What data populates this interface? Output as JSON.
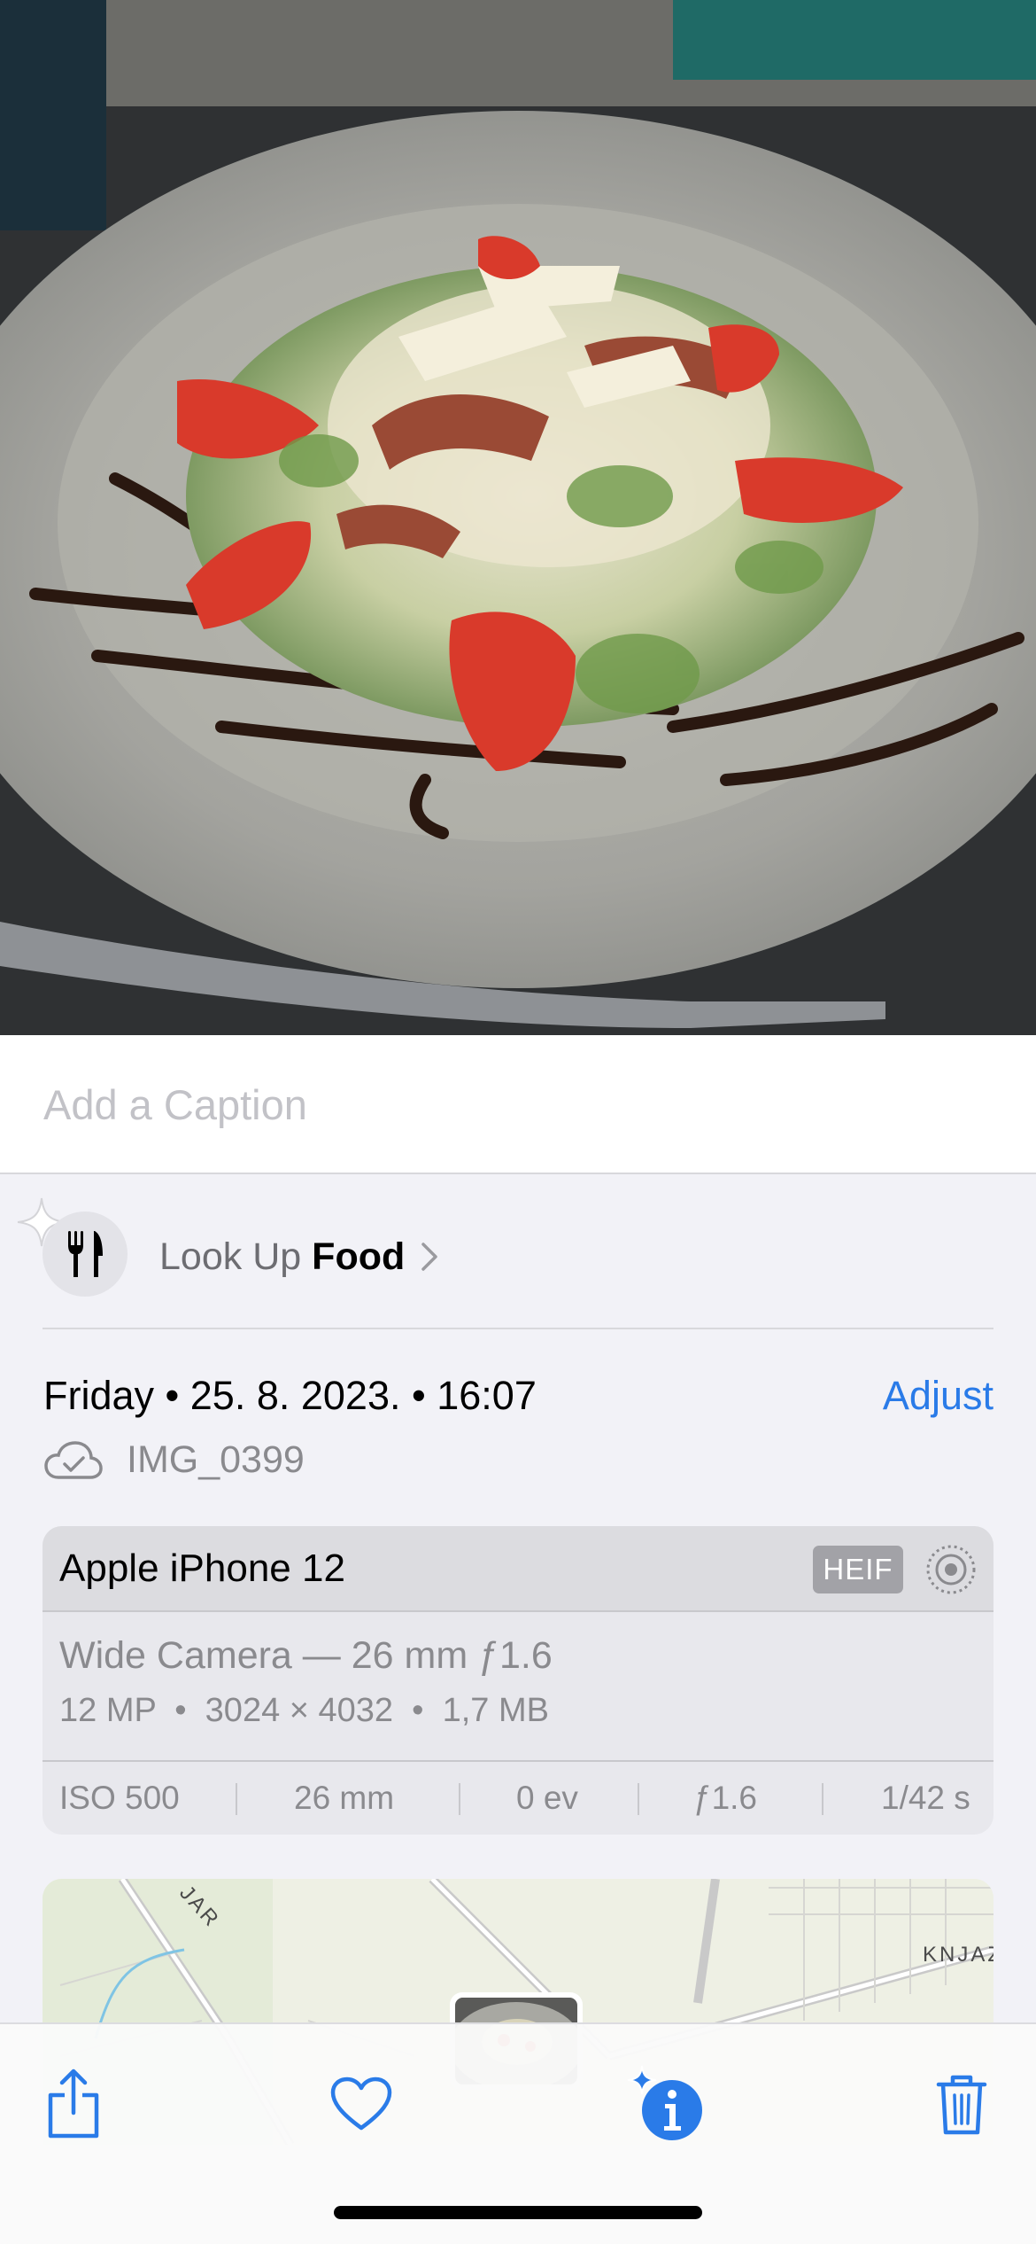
{
  "caption": {
    "placeholder": "Add a Caption",
    "value": ""
  },
  "lookup": {
    "prefix": "Look Up",
    "subject": "Food",
    "icon": "fork-knife-icon"
  },
  "meta": {
    "date": "Friday • 25. 8. 2023. • 16:07",
    "adjust_label": "Adjust",
    "filename": "IMG_0399"
  },
  "device": {
    "name": "Apple iPhone 12",
    "format_badge": "HEIF",
    "camera": "Wide Camera — 26 mm ƒ1.6",
    "specs": "12 MP  •  3024 × 4032  •  1,7 MB",
    "exif": {
      "iso": "ISO 500",
      "focal": "26 mm",
      "ev": "0 ev",
      "aperture": "ƒ1.6",
      "shutter": "1/42 s"
    }
  },
  "map": {
    "label_left": "JAR",
    "label_right": "KNJAZ"
  },
  "colors": {
    "accent": "#2a7be8",
    "background": "#f2f2f7"
  }
}
